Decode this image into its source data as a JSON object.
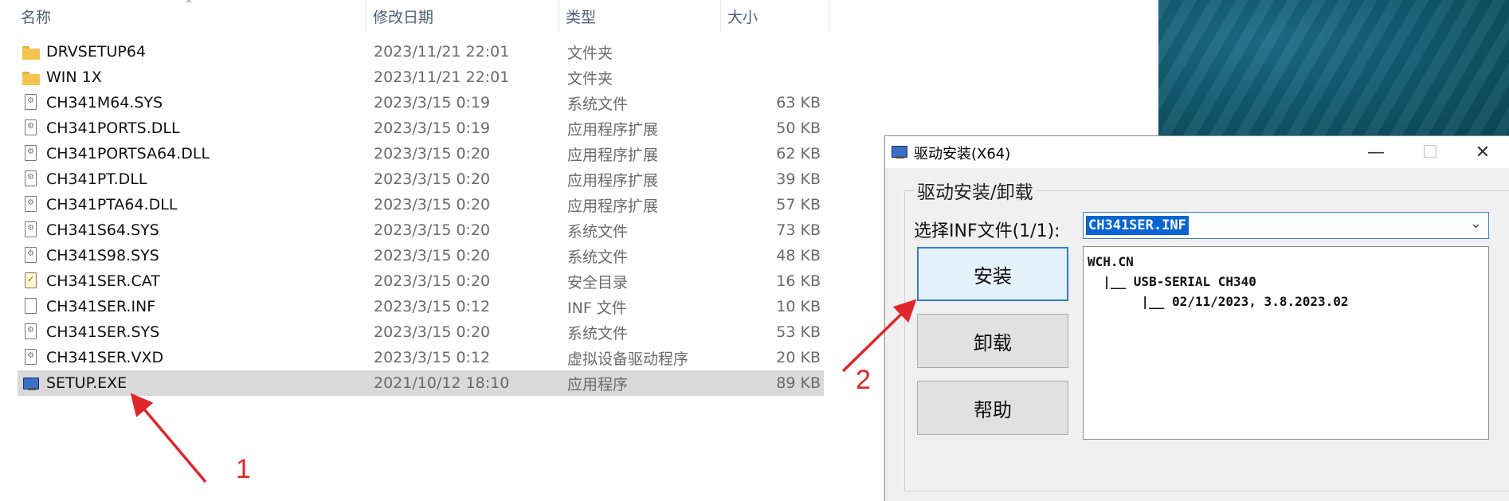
{
  "explorer": {
    "columns": {
      "name": "名称",
      "date": "修改日期",
      "type": "类型",
      "size": "大小"
    },
    "files": [
      {
        "name": "DRVSETUP64",
        "date": "2023/11/21 22:01",
        "type": "文件夹",
        "size": "",
        "icon": "folder-icon"
      },
      {
        "name": "WIN 1X",
        "date": "2023/11/21 22:01",
        "type": "文件夹",
        "size": "",
        "icon": "folder-icon"
      },
      {
        "name": "CH341M64.SYS",
        "date": "2023/3/15 0:19",
        "type": "系统文件",
        "size": "63 KB",
        "icon": "system-file-icon"
      },
      {
        "name": "CH341PORTS.DLL",
        "date": "2023/3/15 0:19",
        "type": "应用程序扩展",
        "size": "50 KB",
        "icon": "dll-file-icon"
      },
      {
        "name": "CH341PORTSA64.DLL",
        "date": "2023/3/15 0:20",
        "type": "应用程序扩展",
        "size": "62 KB",
        "icon": "dll-file-icon"
      },
      {
        "name": "CH341PT.DLL",
        "date": "2023/3/15 0:20",
        "type": "应用程序扩展",
        "size": "39 KB",
        "icon": "dll-file-icon"
      },
      {
        "name": "CH341PTA64.DLL",
        "date": "2023/3/15 0:20",
        "type": "应用程序扩展",
        "size": "57 KB",
        "icon": "dll-file-icon"
      },
      {
        "name": "CH341S64.SYS",
        "date": "2023/3/15 0:20",
        "type": "系统文件",
        "size": "73 KB",
        "icon": "system-file-icon"
      },
      {
        "name": "CH341S98.SYS",
        "date": "2023/3/15 0:20",
        "type": "系统文件",
        "size": "48 KB",
        "icon": "system-file-icon"
      },
      {
        "name": "CH341SER.CAT",
        "date": "2023/3/15 0:20",
        "type": "安全目录",
        "size": "16 KB",
        "icon": "security-catalog-icon"
      },
      {
        "name": "CH341SER.INF",
        "date": "2023/3/15 0:12",
        "type": "INF 文件",
        "size": "10 KB",
        "icon": "inf-file-icon"
      },
      {
        "name": "CH341SER.SYS",
        "date": "2023/3/15 0:20",
        "type": "系统文件",
        "size": "53 KB",
        "icon": "system-file-icon"
      },
      {
        "name": "CH341SER.VXD",
        "date": "2023/3/15 0:12",
        "type": "虚拟设备驱动程序",
        "size": "20 KB",
        "icon": "vxd-file-icon"
      },
      {
        "name": "SETUP.EXE",
        "date": "2021/10/12 18:10",
        "type": "应用程序",
        "size": "89 KB",
        "icon": "exe-file-icon",
        "selected": true
      }
    ]
  },
  "dialog": {
    "title": "驱动安装(X64)",
    "group_label": "驱动安装/卸载",
    "inf_label": "选择INF文件(1/1):",
    "inf_value": "CH341SER.INF",
    "buttons": {
      "install": "安装",
      "uninstall": "卸载",
      "help": "帮助"
    },
    "info_text": "WCH.CN\n  |__ USB-SERIAL CH340\n       |__ 02/11/2023, 3.8.2023.02"
  },
  "annotations": {
    "step1": "1",
    "step2": "2",
    "color": "#e0262b"
  }
}
